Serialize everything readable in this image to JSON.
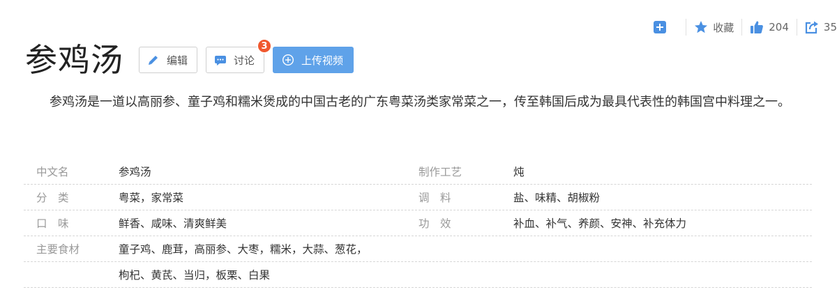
{
  "toolbar": {
    "collect_label": "收藏",
    "like_count": "204",
    "share_count": "35"
  },
  "header": {
    "title": "参鸡汤",
    "edit_label": "编辑",
    "discuss_label": "讨论",
    "discuss_badge": "3",
    "upload_label": "上传视频"
  },
  "summary": "参鸡汤是一道以高丽参、童子鸡和糯米煲成的中国古老的广东粤菜汤类家常菜之一，传至韩国后成为最具代表性的韩国宫中料理之一。",
  "info": [
    {
      "label": "中文名",
      "value": "参鸡汤",
      "label2": "制作工艺",
      "value2": "炖"
    },
    {
      "label": "分　类",
      "value": "粤菜，家常菜",
      "label2": "调　料",
      "value2": "盐、味精、胡椒粉"
    },
    {
      "label": "口　味",
      "value": "鲜香、咸味、清爽鲜美",
      "label2": "功　效",
      "value2": "补血、补气、养颜、安神、补充体力"
    },
    {
      "label": "主要食材",
      "value": "童子鸡、鹿茸，高丽参、大枣，糯米，大蒜、葱花，",
      "label2": "",
      "value2": ""
    },
    {
      "label": "",
      "value": "枸杞、黄芪、当归，板栗、白果",
      "label2": "",
      "value2": ""
    }
  ],
  "colors": {
    "accent": "#4a90e2",
    "upload_button": "#5fa2e9",
    "badge": "#f0582e"
  },
  "icons": [
    "add-icon",
    "star-icon",
    "thumbs-up-icon",
    "share-icon",
    "pencil-icon",
    "chat-icon",
    "plus-circle-icon"
  ]
}
